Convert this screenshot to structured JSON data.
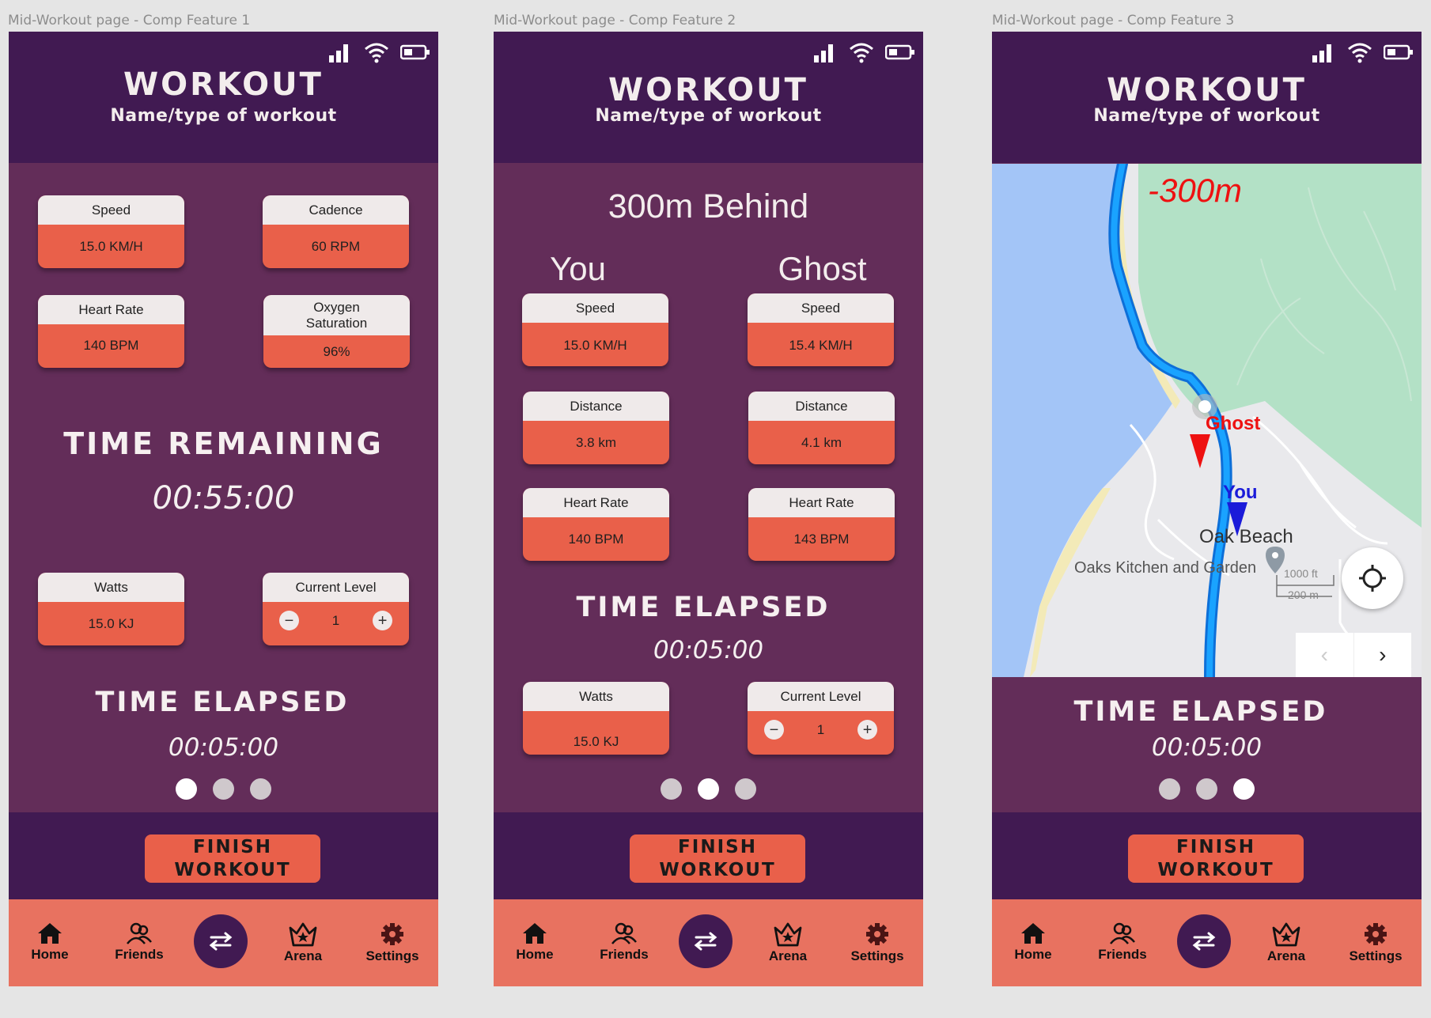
{
  "frames": [
    {
      "label": "Mid-Workout page - Comp Feature 1"
    },
    {
      "label": "Mid-Workout page - Comp Feature 2"
    },
    {
      "label": "Mid-Workout page - Comp Feature 3"
    }
  ],
  "header": {
    "title": "WORKOUT",
    "subtitle": "Name/type of workout"
  },
  "p1": {
    "speed": {
      "label": "Speed",
      "value": "15.0 KM/H"
    },
    "cadence": {
      "label": "Cadence",
      "value": "60 RPM"
    },
    "heart": {
      "label": "Heart Rate",
      "value": "140 BPM"
    },
    "oxygen": {
      "label": "Oxygen Saturation",
      "value": "96%"
    },
    "remaining_title": "TIME REMAINING",
    "remaining_value": "00:55:00",
    "watts": {
      "label": "Watts",
      "value": "15.0 KJ"
    },
    "level": {
      "label": "Current Level",
      "value": "1"
    },
    "elapsed_title": "TIME ELAPSED",
    "elapsed_value": "00:05:00"
  },
  "p2": {
    "status": "300m Behind",
    "you_label": "You",
    "ghost_label": "Ghost",
    "you": {
      "speed": {
        "label": "Speed",
        "value": "15.0 KM/H"
      },
      "distance": {
        "label": "Distance",
        "value": "3.8 km"
      },
      "heart": {
        "label": "Heart Rate",
        "value": "140 BPM"
      }
    },
    "ghost": {
      "speed": {
        "label": "Speed",
        "value": "15.4 KM/H"
      },
      "distance": {
        "label": "Distance",
        "value": "4.1 km"
      },
      "heart": {
        "label": "Heart Rate",
        "value": "143 BPM"
      }
    },
    "elapsed_title": "TIME ELAPSED",
    "elapsed_value": "00:05:00",
    "watts": {
      "label": "Watts",
      "value": "15.0 KJ"
    },
    "level": {
      "label": "Current Level",
      "value": "1"
    }
  },
  "p3": {
    "map": {
      "offset": "-300m",
      "ghost_label": "Ghost",
      "you_label": "You",
      "place": "Oak Beach",
      "poi": "Oaks Kitchen and Garden",
      "scale_ft": "1000 ft",
      "scale_m": "200 m"
    },
    "elapsed_title": "TIME ELAPSED",
    "elapsed_value": "00:05:00"
  },
  "finish_line1": "FINISH",
  "finish_line2": "WORKOUT",
  "nav": {
    "home": "Home",
    "friends": "Friends",
    "arena": "Arena",
    "settings": "Settings"
  },
  "colors": {
    "header": "#411a52",
    "body": "#632d59",
    "card": "#e9604a",
    "nav": "#e87260"
  }
}
